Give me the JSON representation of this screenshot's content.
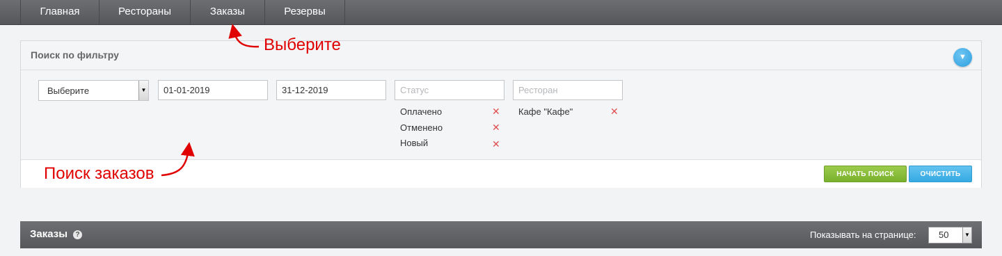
{
  "nav": {
    "tabs": [
      {
        "label": "Главная"
      },
      {
        "label": "Рестораны"
      },
      {
        "label": "Заказы"
      },
      {
        "label": "Резервы"
      }
    ]
  },
  "filter": {
    "title": "Поиск по фильтру",
    "toggle_icon": "chevron-down-icon",
    "select_value": "Выберите",
    "date_from": "01-01-2019",
    "date_to": "31-12-2019",
    "status_placeholder": "Статус",
    "restaurant_placeholder": "Ресторан",
    "statuses": [
      "Оплачено",
      "Отменено",
      "Новый"
    ],
    "restaurants": [
      "Кафе \"Кафе\""
    ],
    "remove_glyph": "✕",
    "search_button": "НАЧАТЬ ПОИСК",
    "clear_button": "ОЧИСТИТЬ"
  },
  "orders": {
    "title": "Заказы",
    "help_glyph": "?",
    "per_page_label": "Показывать на странице:",
    "per_page_value": "50"
  },
  "annotations": {
    "select_hint": "Выберите",
    "search_hint": "Поиск заказов",
    "color": "#e00000"
  },
  "colors": {
    "nav_bg": "#5f6165",
    "search_button": "#8bc13c",
    "clear_button": "#45b2e8"
  }
}
